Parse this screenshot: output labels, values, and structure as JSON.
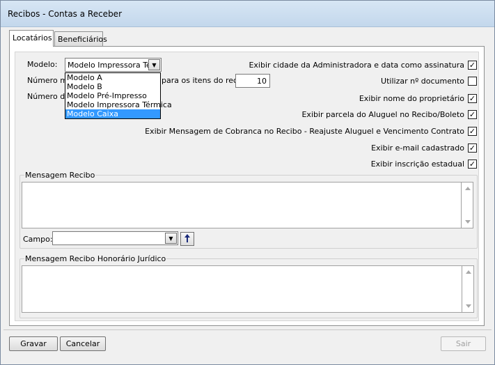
{
  "window": {
    "title": "Recibos - Contas a Receber"
  },
  "tabs": [
    {
      "label": "Locatários"
    },
    {
      "label": "Beneficiários"
    }
  ],
  "form": {
    "modelo_label": "Modelo:",
    "modelo_value": "Modelo Impressora Térmica",
    "modelo_options": [
      "Modelo A",
      "Modelo B",
      "Modelo Pré-Impresso",
      "Modelo Impressora Térmica",
      "Modelo Caixa"
    ],
    "modelo_highlighted": "Modelo Caixa",
    "numero_minimo_label": "Número mí",
    "numero_minimo_label_tail": "para os itens do recib",
    "numero_minimo_value": "10",
    "numero_de_label": "Número de"
  },
  "options": [
    {
      "label": "Exibir cidade da Administradora e data como assinatura",
      "checked": true
    },
    {
      "label": "Utilizar nº documento",
      "checked": false
    },
    {
      "label": "Exibir nome do proprietário",
      "checked": true
    },
    {
      "label": "Exibir parcela do Aluguel no Recibo/Boleto",
      "checked": true
    },
    {
      "label": "Exibir Mensagem de Cobranca no Recibo - Reajuste Aluguel e Vencimento Contrato",
      "checked": true
    },
    {
      "label": "Exibir e-mail cadastrado",
      "checked": true
    },
    {
      "label": "Exibir inscrição estadual",
      "checked": true
    }
  ],
  "mensagem_recibo": {
    "legend": "Mensagem Recibo",
    "text": ""
  },
  "campo": {
    "label": "Campo:",
    "value": ""
  },
  "mensagem_honorario": {
    "legend": "Mensagem Recibo Honorário Jurídico",
    "text": ""
  },
  "buttons": {
    "gravar": "Gravar",
    "cancelar": "Cancelar",
    "sair": "Sair"
  },
  "check_mark": "✓"
}
